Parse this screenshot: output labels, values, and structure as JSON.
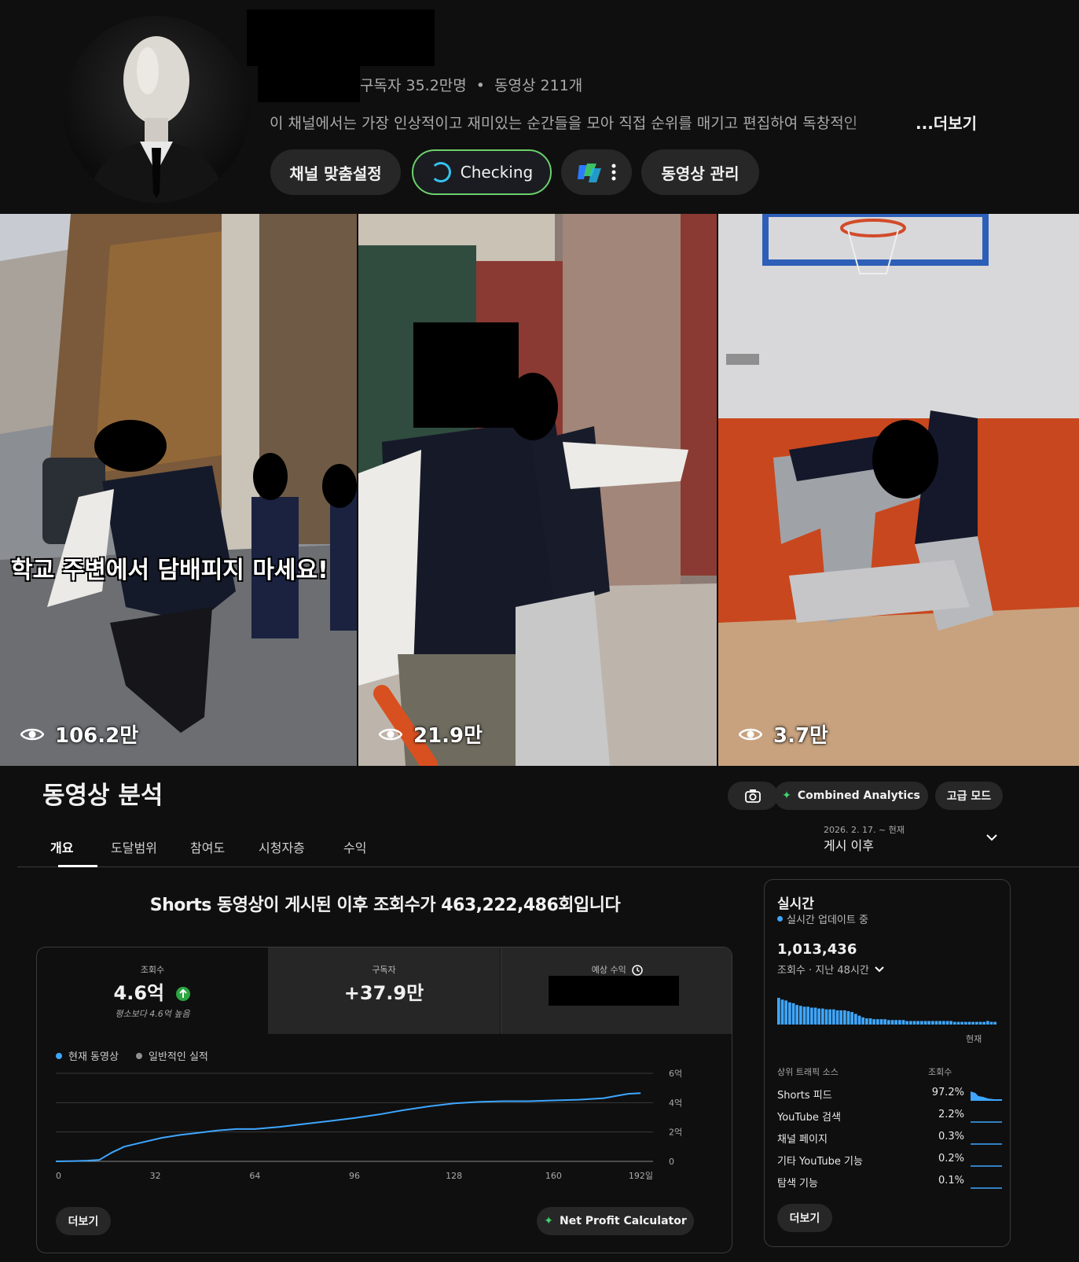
{
  "channel": {
    "subscribers": "구독자 35.2만명",
    "separator": "•",
    "video_count": "동영상 211개",
    "description": "이 채널에서는 가장 인상적이고 재미있는 순간들을 모아 직접 순위를 매기고 편집하여 독창적인",
    "more_label": "...더보기",
    "buttons": {
      "customize": "채널 맞춤설정",
      "checking": "Checking",
      "manage": "동영상 관리"
    }
  },
  "shorts": [
    {
      "views": "106.2만",
      "caption": "학교 주변에서 담배피지 마세요!"
    },
    {
      "views": "21.9만"
    },
    {
      "views": "3.7만"
    }
  ],
  "analytics": {
    "title": "동영상 분석",
    "combined_label": "Combined Analytics",
    "advanced_label": "고급 모드",
    "tabs": [
      "개요",
      "도달범위",
      "참여도",
      "시청자층",
      "수익"
    ],
    "date_range_sub": "2026. 2. 17. ~ 현재",
    "date_range_main": "게시 이후",
    "headline": "Shorts 동영상이 게시된 이후 조회수가 463,222,486회입니다",
    "metrics": {
      "views_label": "조회수",
      "views_value": "4.6억",
      "views_note": "평소보다 4.6억 높음",
      "subs_label": "구독자",
      "subs_value": "+37.9만",
      "revenue_label": "예상 수익"
    },
    "legend": {
      "current": "현재 동영상",
      "typical": "일반적인 실적"
    },
    "more_label": "더보기",
    "net_profit_label": "Net Profit Calculator"
  },
  "chart_data": {
    "type": "line",
    "x_ticks": [
      "0",
      "32",
      "64",
      "96",
      "128",
      "160",
      "192일"
    ],
    "y_ticks": [
      "6억",
      "4억",
      "2억",
      "0"
    ],
    "xlim": [
      0,
      192
    ],
    "ylim": [
      0,
      6
    ],
    "series": [
      {
        "name": "현재 동영상",
        "color": "#3ea6ff",
        "x": [
          0,
          6,
          10,
          14,
          18,
          22,
          28,
          34,
          40,
          46,
          52,
          58,
          64,
          72,
          80,
          88,
          96,
          104,
          112,
          120,
          128,
          136,
          144,
          152,
          160,
          168,
          176,
          180,
          184,
          188
        ],
        "y": [
          0,
          0.02,
          0.05,
          0.1,
          0.6,
          1.0,
          1.3,
          1.6,
          1.8,
          1.95,
          2.1,
          2.2,
          2.2,
          2.35,
          2.55,
          2.75,
          2.95,
          3.2,
          3.5,
          3.75,
          3.95,
          4.05,
          4.1,
          4.1,
          4.15,
          4.2,
          4.3,
          4.45,
          4.6,
          4.65
        ]
      }
    ],
    "grid": true
  },
  "realtime": {
    "title": "실시간",
    "status": "실시간 업데이트 중",
    "count": "1,013,436",
    "count_label": "조회수 · 지난 48시간",
    "now_label": "현재",
    "sources_header": "상위 트래픽 소스",
    "views_header": "조회수",
    "sources": [
      {
        "name": "Shorts 피드",
        "pct": "97.2%"
      },
      {
        "name": "YouTube 검색",
        "pct": "2.2%"
      },
      {
        "name": "채널 페이지",
        "pct": "0.3%"
      },
      {
        "name": "기타 YouTube 기능",
        "pct": "0.2%"
      },
      {
        "name": "탐색 기능",
        "pct": "0.1%"
      }
    ],
    "bars": [
      30,
      28,
      27,
      25,
      24,
      22,
      21,
      20,
      20,
      19,
      19,
      18,
      18,
      17,
      17,
      17,
      16,
      16,
      16,
      15,
      14,
      12,
      10,
      8,
      7,
      7,
      6,
      6,
      6,
      6,
      5,
      5,
      5,
      5,
      5,
      4,
      4,
      4,
      4,
      4,
      4,
      4,
      4,
      4,
      4,
      4,
      4,
      4,
      3,
      3,
      3,
      3,
      3,
      3,
      3,
      3,
      3,
      4,
      3,
      3
    ],
    "more_label": "더보기"
  }
}
